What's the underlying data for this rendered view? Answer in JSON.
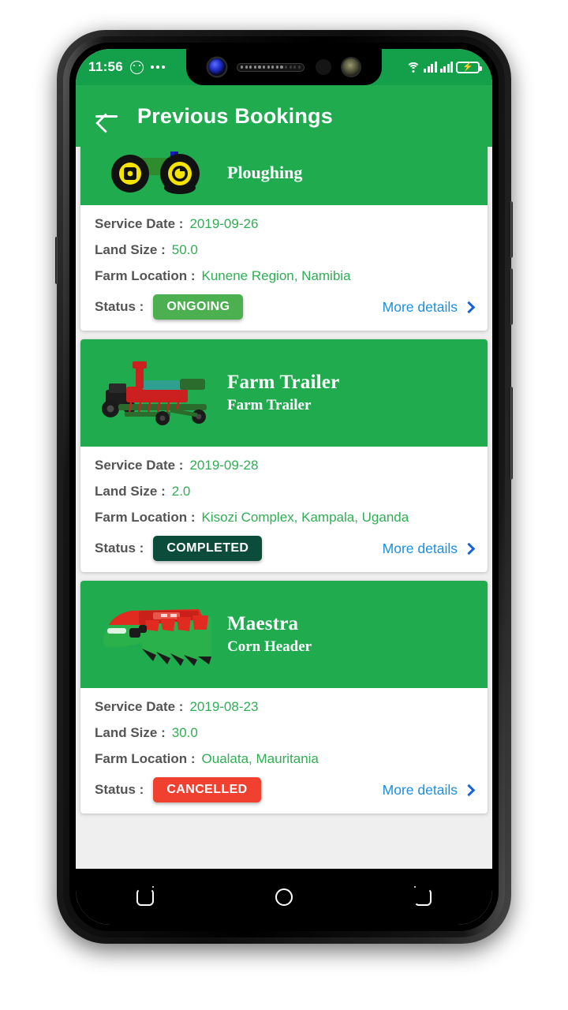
{
  "status_bar": {
    "time": "11:56",
    "icons": [
      "smiley-icon",
      "more-dots-icon",
      "wifi-icon",
      "signal-icon",
      "signal-icon-2",
      "battery-charging-icon"
    ]
  },
  "app_bar": {
    "back_label": "back-arrow-icon",
    "title": "Previous Bookings"
  },
  "labels": {
    "service_date": "Service Date :",
    "land_size": "Land Size :",
    "farm_location": "Farm Location :",
    "status": "Status :",
    "more_details": "More details"
  },
  "bookings": [
    {
      "title": "",
      "subtitle": "Ploughing",
      "machine_icon": "green-tractor-icon",
      "service_date": "2019-09-26",
      "land_size": "50.0",
      "farm_location": "Kunene Region, Namibia",
      "status": "ONGOING",
      "status_color": "#4caf50",
      "clipped": true
    },
    {
      "title": "Farm Trailer",
      "subtitle": "Farm Trailer",
      "machine_icon": "farm-trailer-icon",
      "service_date": "2019-09-28",
      "land_size": "2.0",
      "farm_location": "Kisozi Complex, Kampala, Uganda",
      "status": "COMPLETED",
      "status_color": "#0b4c3a",
      "clipped": false
    },
    {
      "title": "Maestra",
      "subtitle": "Corn Header",
      "machine_icon": "corn-header-icon",
      "service_date": "2019-08-23",
      "land_size": "30.0",
      "farm_location": "Oualata, Mauritania",
      "status": "CANCELLED",
      "status_color": "#f0402f",
      "clipped": false
    }
  ],
  "nav_bar": {
    "items": [
      "recents-icon",
      "home-icon",
      "back-icon"
    ]
  },
  "colors": {
    "brand_green": "#20ab4f",
    "status_bar_green": "#14a04a",
    "value_green": "#2fae53",
    "label_gray": "#545454",
    "link_blue": "#1a8fe0"
  }
}
